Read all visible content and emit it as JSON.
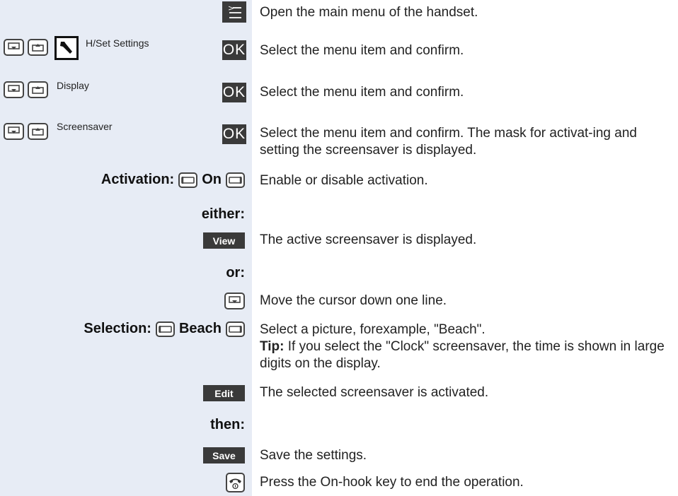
{
  "rows": {
    "menu": {
      "desc": "Open the main menu of the handset."
    },
    "hset": {
      "item": "H/Set Settings",
      "ok": "OK",
      "desc": "Select the menu item and confirm."
    },
    "display": {
      "item": "Display",
      "ok": "OK",
      "desc": "Select the menu item and confirm."
    },
    "screensaver": {
      "item": "Screensaver",
      "ok": "OK",
      "desc": "Select the menu item and confirm. The mask for activat-ing and setting the screensaver is displayed."
    },
    "activation": {
      "label": "Activation:",
      "value": "On",
      "desc": "Enable or disable activation."
    },
    "either": {
      "label": "either:"
    },
    "view": {
      "softkey": "View",
      "desc": "The active screensaver is displayed."
    },
    "or": {
      "label": "or:"
    },
    "cursor": {
      "desc": "Move the cursor down one line."
    },
    "selection": {
      "label": "Selection:",
      "value": "Beach",
      "desc": "Select a picture, forexample, \"Beach\".",
      "tip_label": "Tip:",
      "tip": "If you select the \"Clock\" screensaver, the time is shown in large digits on the display."
    },
    "edit": {
      "softkey": "Edit",
      "desc": "The selected screensaver is activated."
    },
    "then": {
      "label": "then:"
    },
    "save": {
      "softkey": "Save",
      "desc": "Save the settings."
    },
    "onhook": {
      "desc": "Press the On-hook key to end the operation."
    }
  },
  "colors": {
    "left_panel": "#e7ecf5",
    "key_dark": "#3a3a3a"
  },
  "icons": [
    "menu-icon",
    "down-arrow-key-icon",
    "up-arrow-key-icon",
    "wrench-icon",
    "left-softkey-icon",
    "right-softkey-icon",
    "on-hook-key-icon"
  ]
}
